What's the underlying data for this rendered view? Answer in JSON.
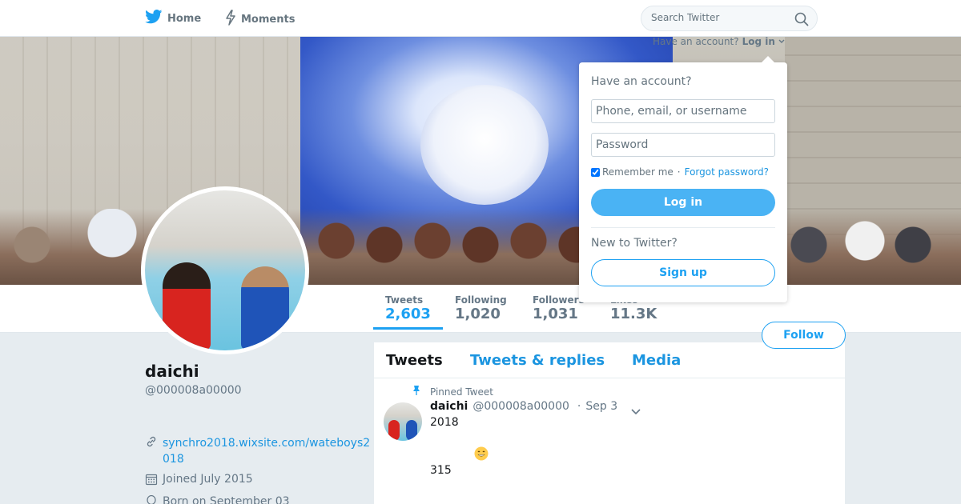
{
  "nav": {
    "home_label": "Home",
    "moments_label": "Moments",
    "search_placeholder": "Search Twitter",
    "icons": [
      "twitter-bird-icon",
      "lightning-icon",
      "search-icon"
    ]
  },
  "login_trigger": {
    "prompt": "Have an account?",
    "link": "Log in"
  },
  "login_dropdown": {
    "title": "Have an account?",
    "username_placeholder": "Phone, email, or username",
    "password_placeholder": "Password",
    "remember_label": "Remember me",
    "separator": "·",
    "forgot_label": "Forgot password?",
    "login_button": "Log in",
    "new_label": "New to Twitter?",
    "signup_button": "Sign up"
  },
  "stats": {
    "tweets": {
      "label": "Tweets",
      "value": "2,603"
    },
    "following": {
      "label": "Following",
      "value": "1,020"
    },
    "followers": {
      "label": "Followers",
      "value": "1,031"
    },
    "likes": {
      "label": "Likes",
      "value": "11.3K"
    }
  },
  "follow_button": "Follow",
  "profile": {
    "name": "daichi",
    "handle": "@000008a00000",
    "link": "synchro2018.wixsite.com/wateboys2018",
    "joined": "Joined July 2015",
    "born": "Born on September 03"
  },
  "tabs": {
    "tweets": "Tweets",
    "replies": "Tweets & replies",
    "media": "Media"
  },
  "tweet": {
    "pinned_label": "Pinned Tweet",
    "name": "daichi",
    "handle": "@000008a00000",
    "sep": "·",
    "date": "Sep 3",
    "line1": "2018",
    "emoji": "😄",
    "line3": "315"
  },
  "colors": {
    "brand": "#1da1f2",
    "link": "#1b95e0",
    "login_button": "#4ab3f4",
    "page_bg": "#e6ecf0"
  }
}
